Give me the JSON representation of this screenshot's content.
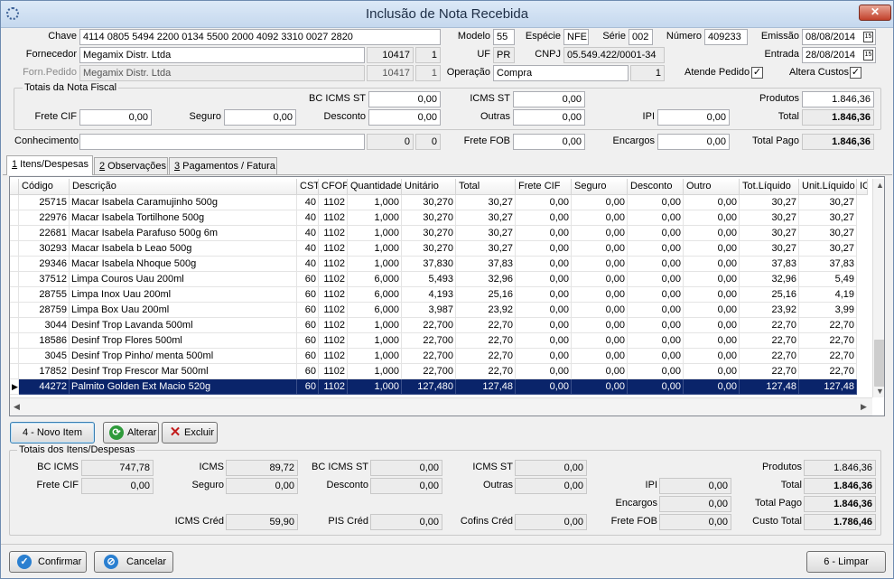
{
  "window": {
    "title": "Inclusão de Nota Recebida",
    "close_label": "✕"
  },
  "header": {
    "chave_label": "Chave",
    "chave_value": "4114 0805 5494 2200 0134 5500 2000 4092 3310 0027 2820",
    "modelo_label": "Modelo",
    "modelo_value": "55",
    "especie_label": "Espécie",
    "especie_value": "NFE",
    "serie_label": "Série",
    "serie_value": "002",
    "numero_label": "Número",
    "numero_value": "409233",
    "emissao_label": "Emissão",
    "emissao_value": "08/08/2014",
    "entrada_label": "Entrada",
    "entrada_value": "28/08/2014",
    "fornecedor_label": "Fornecedor",
    "fornecedor_value": "Megamix Distr. Ltda",
    "fornecedor_code": "10417",
    "fornecedor_seq": "1",
    "uf_label": "UF",
    "uf_value": "PR",
    "cnpj_label": "CNPJ",
    "cnpj_value": "05.549.422/0001-34",
    "forn_pedido_label": "Forn.Pedido",
    "forn_pedido_value": "Megamix Distr. Ltda",
    "forn_pedido_code": "10417",
    "forn_pedido_seq": "1",
    "operacao_label": "Operação",
    "operacao_value": "Compra",
    "operacao_code": "1",
    "atende_pedido_label": "Atende Pedido",
    "altera_custos_label": "Altera Custos",
    "check_mark": "✓"
  },
  "totais_nota": {
    "group_label": "Totais da Nota Fiscal",
    "bc_icms_st_label": "BC ICMS ST",
    "bc_icms_st_value": "0,00",
    "icms_st_label": "ICMS ST",
    "icms_st_value": "0,00",
    "produtos_label": "Produtos",
    "produtos_value": "1.846,36",
    "frete_cif_label": "Frete CIF",
    "frete_cif_value": "0,00",
    "seguro_label": "Seguro",
    "seguro_value": "0,00",
    "desconto_label": "Desconto",
    "desconto_value": "0,00",
    "outras_label": "Outras",
    "outras_value": "0,00",
    "ipi_label": "IPI",
    "ipi_value": "0,00",
    "total_label": "Total",
    "total_value": "1.846,36"
  },
  "conhecimento": {
    "label": "Conhecimento",
    "value": "",
    "num1": "0",
    "num2": "0",
    "frete_fob_label": "Frete FOB",
    "frete_fob_value": "0,00",
    "encargos_label": "Encargos",
    "encargos_value": "0,00",
    "total_pago_label": "Total Pago",
    "total_pago_value": "1.846,36"
  },
  "tabs": [
    {
      "key": "1",
      "label": " Itens/Despesas"
    },
    {
      "key": "2",
      "label": " Observações"
    },
    {
      "key": "3",
      "label": " Pagamentos / Fatura"
    }
  ],
  "grid": {
    "columns": [
      "Código",
      "Descrição",
      "CST",
      "CFOP",
      "Quantidade",
      "Unitário",
      "Total",
      "Frete CIF",
      "Seguro",
      "Desconto",
      "Outro",
      "Tot.Líquido",
      "Unit.Líquido",
      "IC"
    ],
    "rows": [
      [
        "25715",
        "Macar Isabela Caramujinho 500g",
        "40",
        "1102",
        "1,000",
        "30,270",
        "30,27",
        "0,00",
        "0,00",
        "0,00",
        "0,00",
        "30,27",
        "30,27"
      ],
      [
        "22976",
        "Macar Isabela Tortilhone 500g",
        "40",
        "1102",
        "1,000",
        "30,270",
        "30,27",
        "0,00",
        "0,00",
        "0,00",
        "0,00",
        "30,27",
        "30,27"
      ],
      [
        "22681",
        "Macar Isabela Parafuso 500g 6m",
        "40",
        "1102",
        "1,000",
        "30,270",
        "30,27",
        "0,00",
        "0,00",
        "0,00",
        "0,00",
        "30,27",
        "30,27"
      ],
      [
        "30293",
        "Macar Isabela b Leao 500g",
        "40",
        "1102",
        "1,000",
        "30,270",
        "30,27",
        "0,00",
        "0,00",
        "0,00",
        "0,00",
        "30,27",
        "30,27"
      ],
      [
        "29346",
        "Macar Isabela Nhoque 500g",
        "40",
        "1102",
        "1,000",
        "37,830",
        "37,83",
        "0,00",
        "0,00",
        "0,00",
        "0,00",
        "37,83",
        "37,83"
      ],
      [
        "37512",
        "Limpa Couros Uau 200ml",
        "60",
        "1102",
        "6,000",
        "5,493",
        "32,96",
        "0,00",
        "0,00",
        "0,00",
        "0,00",
        "32,96",
        "5,49"
      ],
      [
        "28755",
        "Limpa Inox Uau 200ml",
        "60",
        "1102",
        "6,000",
        "4,193",
        "25,16",
        "0,00",
        "0,00",
        "0,00",
        "0,00",
        "25,16",
        "4,19"
      ],
      [
        "28759",
        "Limpa Box Uau 200ml",
        "60",
        "1102",
        "6,000",
        "3,987",
        "23,92",
        "0,00",
        "0,00",
        "0,00",
        "0,00",
        "23,92",
        "3,99"
      ],
      [
        "3044",
        "Desinf Trop Lavanda 500ml",
        "60",
        "1102",
        "1,000",
        "22,700",
        "22,70",
        "0,00",
        "0,00",
        "0,00",
        "0,00",
        "22,70",
        "22,70"
      ],
      [
        "18586",
        "Desinf Trop Flores 500ml",
        "60",
        "1102",
        "1,000",
        "22,700",
        "22,70",
        "0,00",
        "0,00",
        "0,00",
        "0,00",
        "22,70",
        "22,70"
      ],
      [
        "3045",
        "Desinf Trop Pinho/ menta 500ml",
        "60",
        "1102",
        "1,000",
        "22,700",
        "22,70",
        "0,00",
        "0,00",
        "0,00",
        "0,00",
        "22,70",
        "22,70"
      ],
      [
        "17852",
        "Desinf Trop Frescor Mar 500ml",
        "60",
        "1102",
        "1,000",
        "22,700",
        "22,70",
        "0,00",
        "0,00",
        "0,00",
        "0,00",
        "22,70",
        "22,70"
      ],
      [
        "44272",
        "Palmito Golden Ext Macio 520g",
        "60",
        "1102",
        "1,000",
        "127,480",
        "127,48",
        "0,00",
        "0,00",
        "0,00",
        "0,00",
        "127,48",
        "127,48"
      ]
    ],
    "selected_index": 12
  },
  "item_buttons": {
    "novo_item": "4 - Novo Item",
    "alterar": "Alterar",
    "excluir": "Excluir"
  },
  "totais_itens": {
    "group_label": "Totais dos Itens/Despesas",
    "bc_icms_label": "BC ICMS",
    "bc_icms_value": "747,78",
    "icms_label": "ICMS",
    "icms_value": "89,72",
    "bc_icms_st_label": "BC ICMS ST",
    "bc_icms_st_value": "0,00",
    "icms_st_label": "ICMS ST",
    "icms_st_value": "0,00",
    "produtos_label": "Produtos",
    "produtos_value": "1.846,36",
    "frete_cif_label": "Frete CIF",
    "frete_cif_value": "0,00",
    "seguro_label": "Seguro",
    "seguro_value": "0,00",
    "desconto_label": "Desconto",
    "desconto_value": "0,00",
    "outras_label": "Outras",
    "outras_value": "0,00",
    "ipi_label": "IPI",
    "ipi_value": "0,00",
    "total_label": "Total",
    "total_value": "1.846,36",
    "encargos_label": "Encargos",
    "encargos_value": "0,00",
    "total_pago_label": "Total Pago",
    "total_pago_value": "1.846,36",
    "icms_cred_label": "ICMS Créd",
    "icms_cred_value": "59,90",
    "pis_cred_label": "PIS Créd",
    "pis_cred_value": "0,00",
    "cofins_cred_label": "Cofins Créd",
    "cofins_cred_value": "0,00",
    "frete_fob_label": "Frete FOB",
    "frete_fob_value": "0,00",
    "custo_total_label": "Custo Total",
    "custo_total_value": "1.786,46"
  },
  "footer": {
    "confirmar": "Confirmar",
    "cancelar": "Cancelar",
    "limpar": "6 - Limpar"
  }
}
